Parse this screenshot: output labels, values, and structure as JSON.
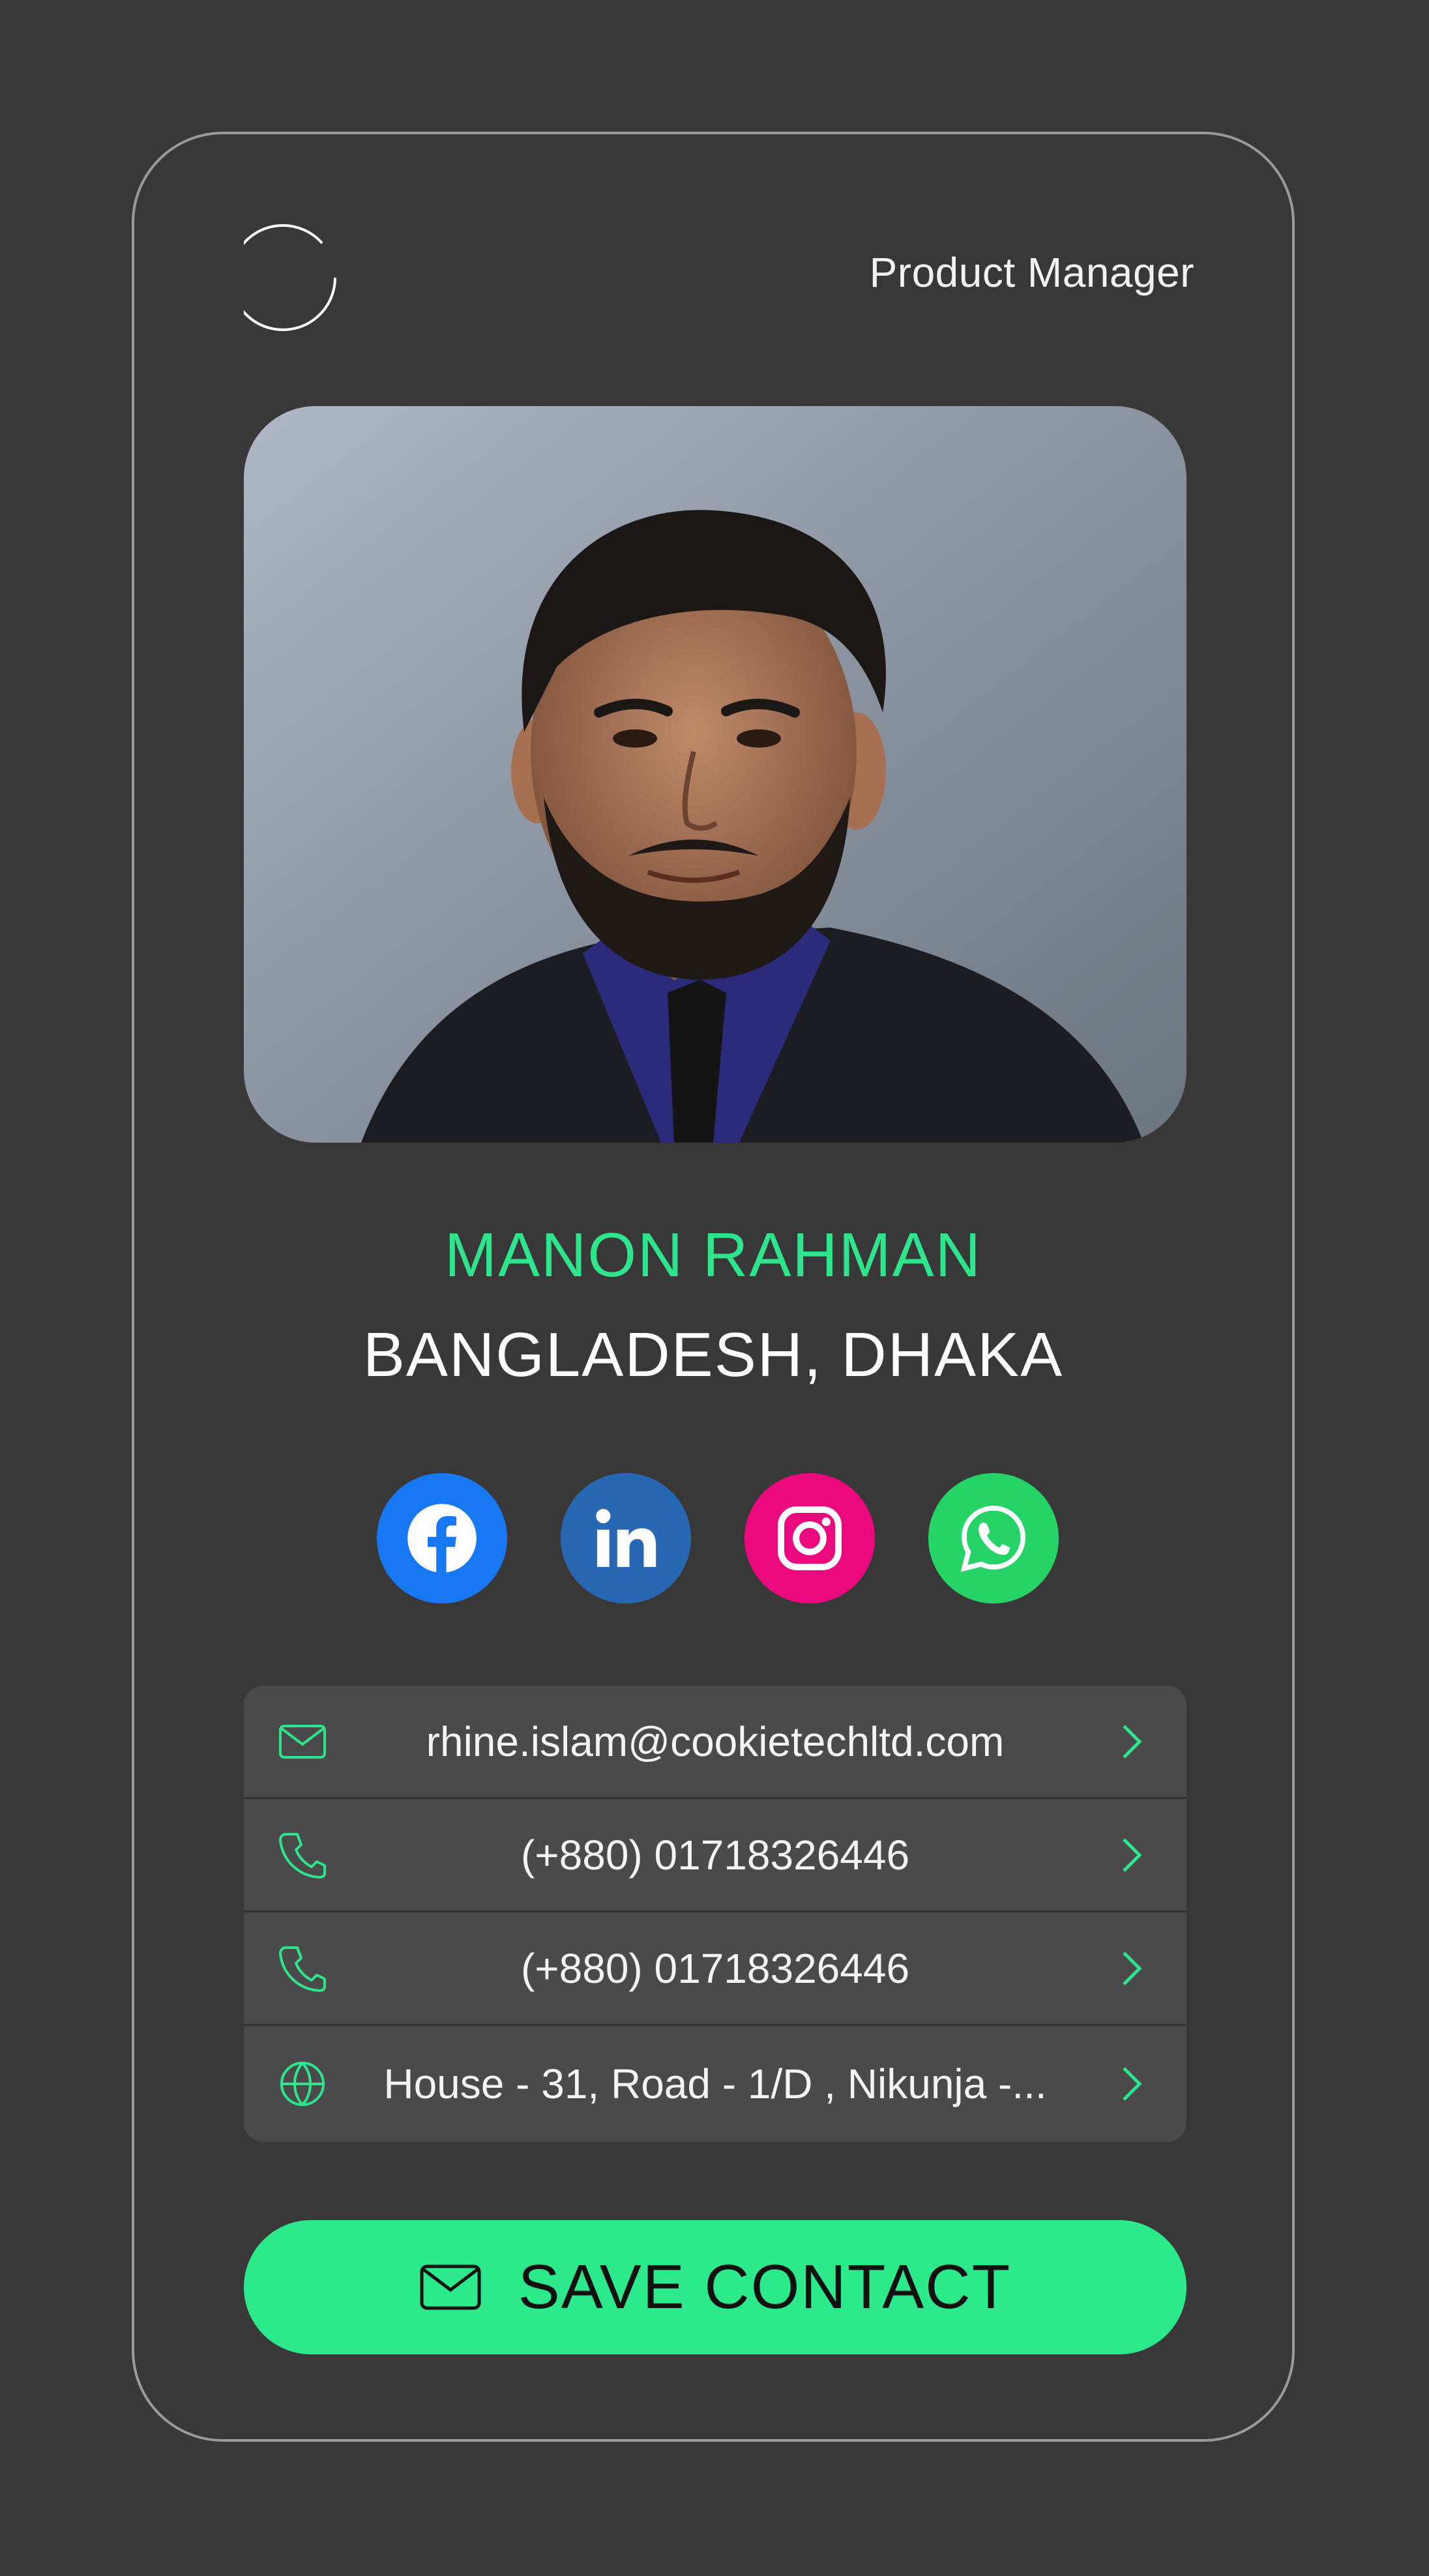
{
  "header": {
    "role": "Product Manager",
    "logo_icon": "ring-logo-icon"
  },
  "profile": {
    "name": "MANON RAHMAN",
    "location": "BANGLADESH, DHAKA",
    "photo": "profile-photo"
  },
  "socials": [
    {
      "name": "facebook",
      "icon": "facebook-icon",
      "color": "#1877f2"
    },
    {
      "name": "linkedin",
      "icon": "linkedin-icon",
      "color": "#2867b2"
    },
    {
      "name": "instagram",
      "icon": "instagram-icon",
      "color": "#ea0a7e"
    },
    {
      "name": "whatsapp",
      "icon": "whatsapp-icon",
      "color": "#25d366"
    }
  ],
  "contacts": [
    {
      "icon": "mail-icon",
      "text": "rhine.islam@cookietechltd.com"
    },
    {
      "icon": "phone-icon",
      "text": "(+880) 01718326446"
    },
    {
      "icon": "phone-icon",
      "text": "(+880) 01718326446"
    },
    {
      "icon": "globe-icon",
      "text": "House - 31, Road - 1/D , Nikunja -..."
    }
  ],
  "save_button": {
    "label": "SAVE CONTACT",
    "icon": "mail-icon"
  },
  "colors": {
    "background": "#383838",
    "accent": "#2ee58e",
    "list_bg": "#4a4a4a"
  }
}
